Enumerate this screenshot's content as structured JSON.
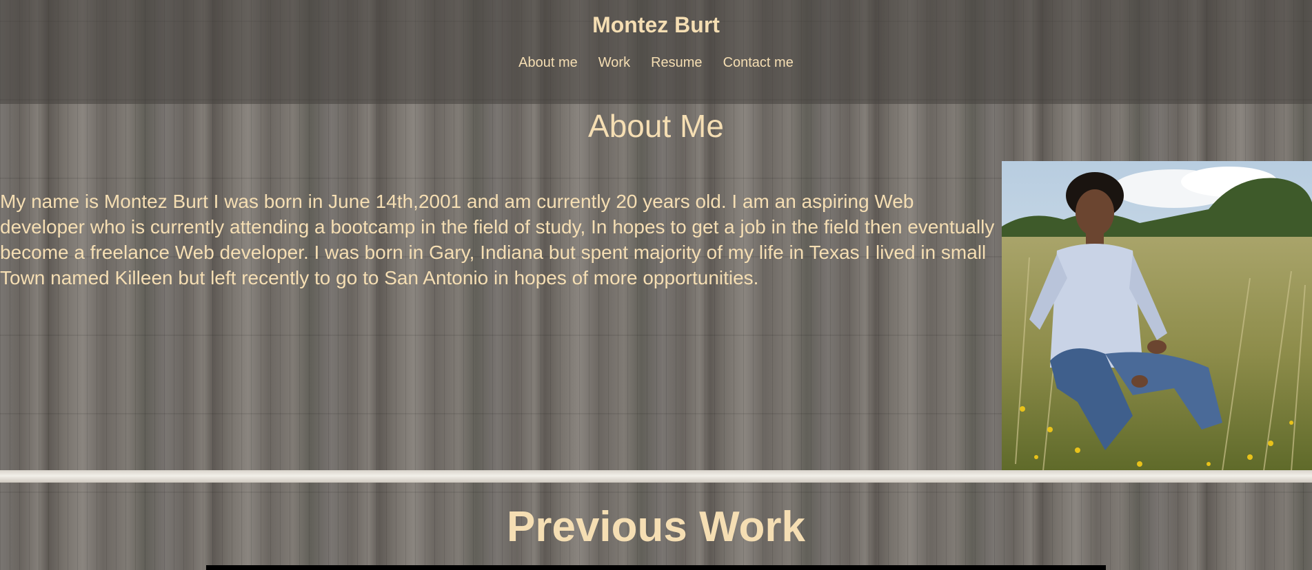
{
  "header": {
    "title": "Montez Burt",
    "nav": [
      "About me",
      "Work",
      "Resume",
      "Contact me"
    ]
  },
  "about": {
    "heading": "About Me",
    "text": "My name is Montez Burt I was born in June 14th,2001 and am currently 20 years old. I am an aspiring Web developer who is currently attending a bootcamp in the field of study, In hopes to get a job in the field then eventually become a freelance Web developer. I was born in Gary, Indiana but spent majority of my life in Texas I lived in small Town named Killeen but left recently to go to San Antonio in hopes of more opportunities.",
    "photo": "profile-photo"
  },
  "work": {
    "heading": "Previous Work"
  },
  "colors": {
    "text": "#f5deb3",
    "header_overlay": "#46423e"
  }
}
